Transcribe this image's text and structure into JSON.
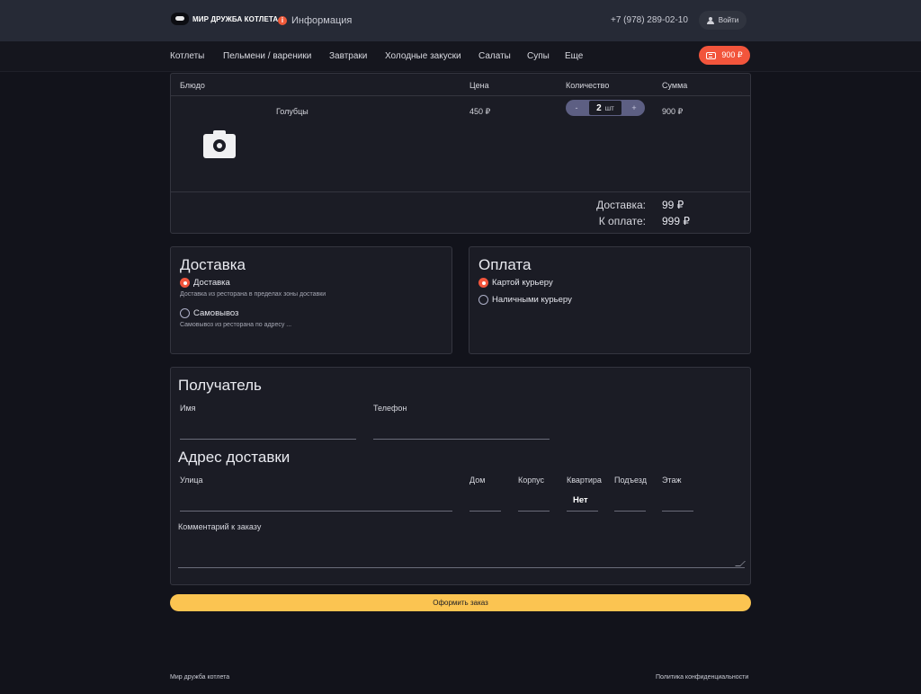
{
  "header": {
    "logo_text": "МИР ДРУЖБА КОТЛЕТА",
    "info_label": "Информация",
    "phone": "+7 (978) 289-02-10",
    "login_label": "Войти"
  },
  "nav": {
    "items": [
      "Котлеты",
      "Пельмени / вареники",
      "Завтраки",
      "Холодные закуски",
      "Салаты",
      "Супы",
      "Еще"
    ],
    "cart_total": "900 ₽"
  },
  "cart": {
    "columns": [
      "Блюдо",
      "Цена",
      "Количество",
      "Сумма"
    ],
    "rows": [
      {
        "name": "Голубцы",
        "price": "450 ₽",
        "quantity": "2",
        "unit": "шт",
        "total": "900 ₽"
      }
    ],
    "delivery_label": "Доставка:",
    "delivery_value": "99 ₽",
    "payable_label": "К оплате:",
    "payable_value": "999 ₽"
  },
  "delivery": {
    "title": "Доставка",
    "options": [
      {
        "label": "Доставка",
        "desc": "Доставка из ресторана в пределах зоны доставки",
        "selected": true
      },
      {
        "label": "Самовывоз",
        "desc": "Самовывоз из ресторана по адресу ...",
        "selected": false
      }
    ]
  },
  "payment": {
    "title": "Оплата",
    "options": [
      {
        "label": "Картой курьеру",
        "selected": true
      },
      {
        "label": "Наличными курьеру",
        "selected": false
      }
    ]
  },
  "recipient": {
    "title": "Получатель",
    "name_label": "Имя",
    "phone_label": "Телефон",
    "address_title": "Адрес доставки",
    "street_label": "Улица",
    "house_label": "Дом",
    "building_label": "Корпус",
    "apartment_label": "Квартира",
    "apartment_value": "Нет",
    "entrance_label": "Подъезд",
    "floor_label": "Этаж",
    "comment_label": "Комментарий к заказу"
  },
  "submit_label": "Оформить заказ",
  "footer": {
    "left": "Мир дружба котлета",
    "right": "Политика конфиденциальности"
  },
  "colors": {
    "accent": "#f2553c",
    "submit": "#fbc451",
    "background": "#12131b",
    "header": "#262a36"
  }
}
